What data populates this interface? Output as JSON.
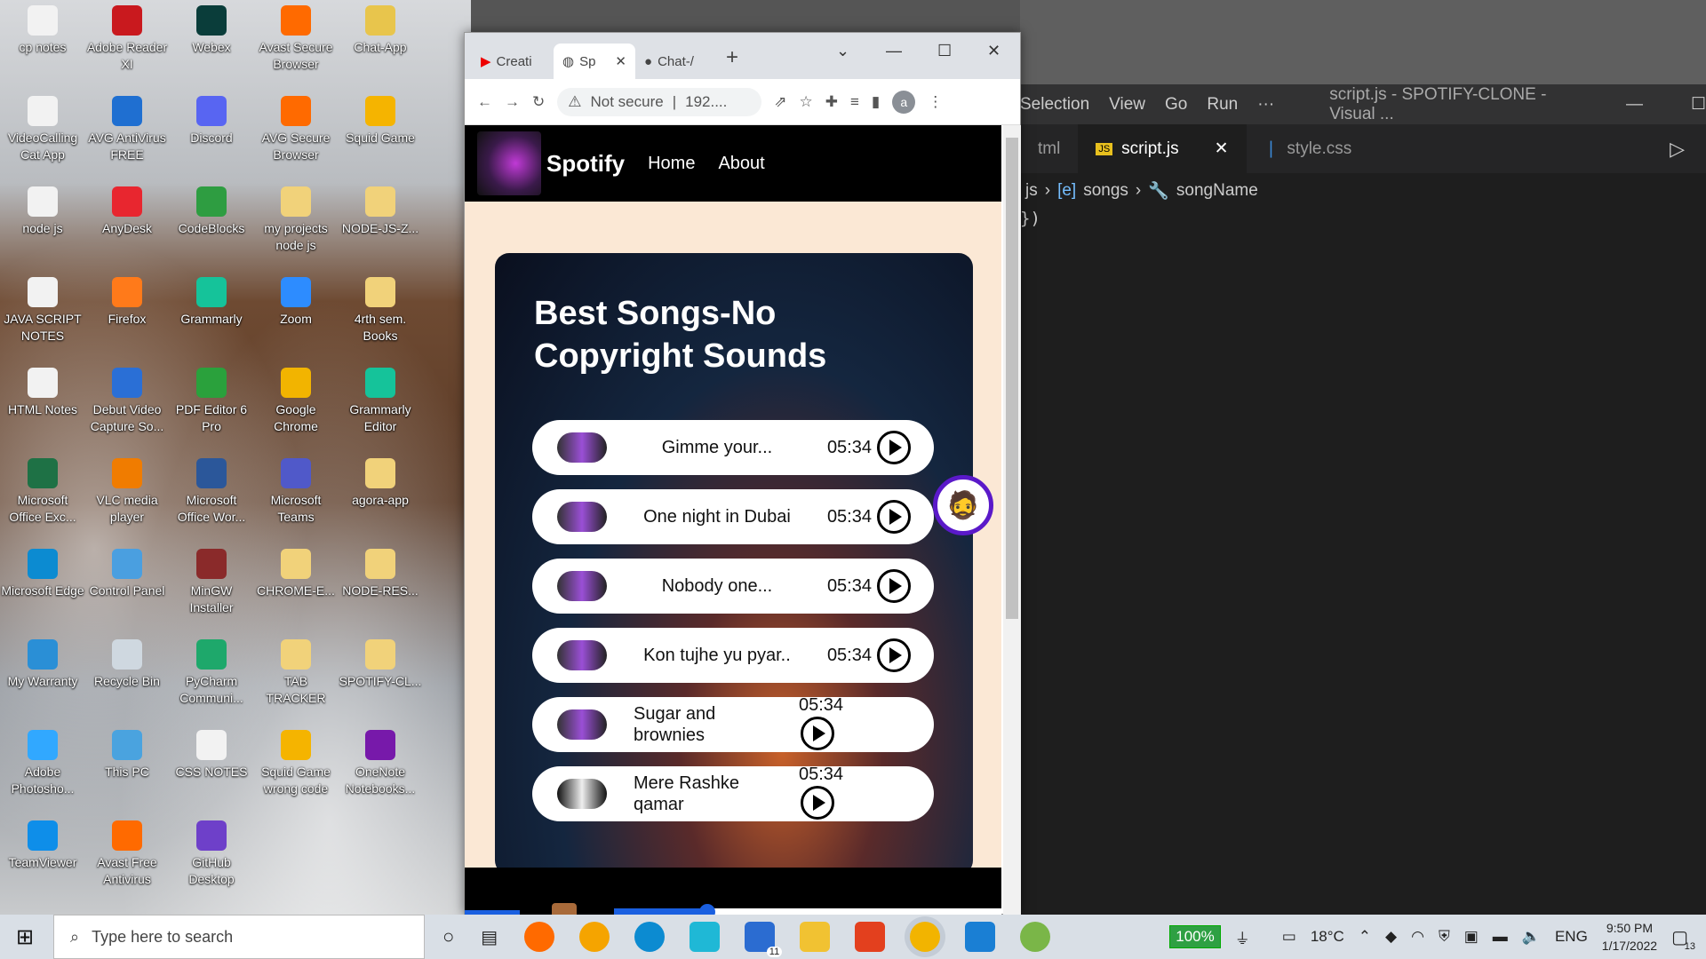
{
  "desktop": {
    "icons": [
      {
        "label": "cp notes",
        "color": "#f2f2f2"
      },
      {
        "label": "Adobe Reader XI",
        "color": "#c9191e"
      },
      {
        "label": "Webex",
        "color": "#0a3d3a"
      },
      {
        "label": "Avast Secure Browser",
        "color": "#ff6a00"
      },
      {
        "label": "Chat-App",
        "color": "#e8c54c"
      },
      {
        "label": "VideoCalling Cat App",
        "color": "#f2f2f2"
      },
      {
        "label": "AVG AntiVirus FREE",
        "color": "#1f6fd1"
      },
      {
        "label": "Discord",
        "color": "#5865f2"
      },
      {
        "label": "AVG Secure Browser",
        "color": "#ff6a00"
      },
      {
        "label": "Squid Game",
        "color": "#f5b400"
      },
      {
        "label": "node js",
        "color": "#f2f2f2"
      },
      {
        "label": "AnyDesk",
        "color": "#e8262f"
      },
      {
        "label": "CodeBlocks",
        "color": "#2e9d41"
      },
      {
        "label": "my projects node js",
        "color": "#f1d27a"
      },
      {
        "label": "NODE-JS-Z...",
        "color": "#f1d27a"
      },
      {
        "label": "JAVA SCRIPT NOTES",
        "color": "#f2f2f2"
      },
      {
        "label": "Firefox",
        "color": "#ff7a1a"
      },
      {
        "label": "Grammarly",
        "color": "#15c39a"
      },
      {
        "label": "Zoom",
        "color": "#2d8cff"
      },
      {
        "label": "4rth sem. Books",
        "color": "#f1d27a"
      },
      {
        "label": "HTML Notes",
        "color": "#f2f2f2"
      },
      {
        "label": "Debut Video Capture So...",
        "color": "#2a6fd6"
      },
      {
        "label": "PDF Editor 6 Pro",
        "color": "#2aa13c"
      },
      {
        "label": "Google Chrome",
        "color": "#f2b400"
      },
      {
        "label": "Grammarly Editor",
        "color": "#15c39a"
      },
      {
        "label": "Microsoft Office Exc...",
        "color": "#1e7145"
      },
      {
        "label": "VLC media player",
        "color": "#f07c00"
      },
      {
        "label": "Microsoft Office Wor...",
        "color": "#2b579a"
      },
      {
        "label": "Microsoft Teams",
        "color": "#5059c9"
      },
      {
        "label": "agora-app",
        "color": "#f1d27a"
      },
      {
        "label": "Microsoft Edge",
        "color": "#0c8bd1"
      },
      {
        "label": "Control Panel",
        "color": "#4a9fe0"
      },
      {
        "label": "MinGW Installer",
        "color": "#8a2a2a"
      },
      {
        "label": "CHROME-E...",
        "color": "#f1d27a"
      },
      {
        "label": "NODE-RES...",
        "color": "#f1d27a"
      },
      {
        "label": "My Warranty",
        "color": "#2a8fd6"
      },
      {
        "label": "Recycle Bin",
        "color": "#cfd8e0"
      },
      {
        "label": "PyCharm Communi...",
        "color": "#1ea86b"
      },
      {
        "label": "TAB TRACKER",
        "color": "#f1d27a"
      },
      {
        "label": "SPOTIFY-CL...",
        "color": "#f1d27a"
      },
      {
        "label": "Adobe Photosho...",
        "color": "#31a8ff"
      },
      {
        "label": "This PC",
        "color": "#4aa3df"
      },
      {
        "label": "CSS NOTES",
        "color": "#f2f2f2"
      },
      {
        "label": "Squid Game wrong code",
        "color": "#f5b400"
      },
      {
        "label": "OneNote Notebooks...",
        "color": "#7719aa"
      },
      {
        "label": "TeamViewer",
        "color": "#0e8ee9"
      },
      {
        "label": "Avast Free Antivirus",
        "color": "#ff6a00"
      },
      {
        "label": "GitHub Desktop",
        "color": "#6e40c9"
      }
    ]
  },
  "vscode": {
    "menu": [
      "Selection",
      "View",
      "Go",
      "Run",
      "···"
    ],
    "title": "script.js - SPOTIFY-CLONE - Visual ...",
    "tabs": [
      {
        "label": "tml"
      },
      {
        "label": "script.js"
      },
      {
        "label": "style.css"
      }
    ],
    "breadcrumb": [
      "js",
      "songs",
      "songName"
    ],
    "code_line": "})"
  },
  "chrome": {
    "tabs": [
      {
        "label": "Creati"
      },
      {
        "label": "Sp"
      },
      {
        "label": "Chat-/"
      }
    ],
    "address": {
      "security": "Not secure",
      "url": "192...."
    },
    "profile_initial": "a"
  },
  "spotify": {
    "brand": "Spotify",
    "nav": [
      "Home",
      "About"
    ],
    "heading": "Best Songs-No Copyright Sounds",
    "songs": [
      {
        "name": "Gimme your...",
        "time": "05:34"
      },
      {
        "name": "One night in Dubai",
        "time": "05:34"
      },
      {
        "name": "Nobody one...",
        "time": "05:34"
      },
      {
        "name": "Kon tujhe yu pyar..",
        "time": "05:34"
      },
      {
        "name": "Sugar and brownies",
        "time": "05:34"
      },
      {
        "name": "Mere Rashke qamar",
        "time": "05:34"
      }
    ],
    "progress_percent": 24
  },
  "taskbar": {
    "search_placeholder": "Type here to search",
    "battery": "100%",
    "temperature": "18°C",
    "language": "ENG",
    "time": "9:50 PM",
    "date": "1/17/2022",
    "notifications": "13",
    "mail_badge": "11"
  }
}
